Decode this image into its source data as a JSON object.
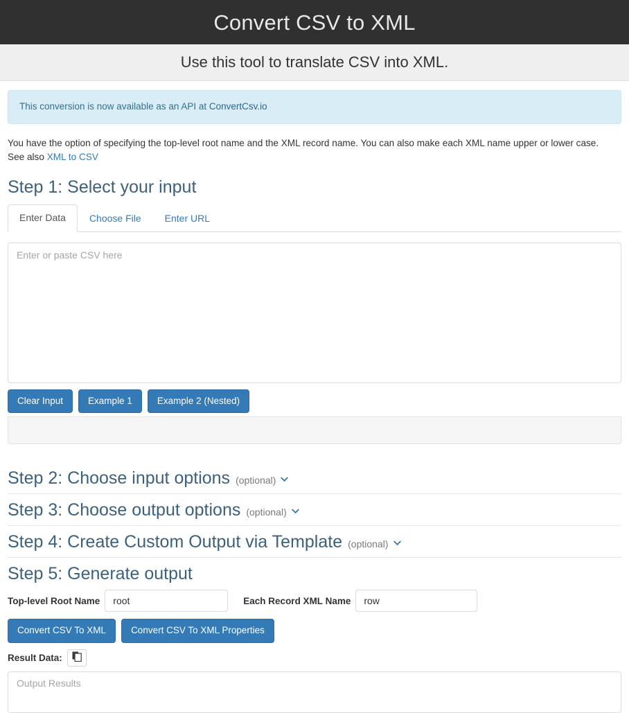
{
  "masthead": {
    "title": "Convert CSV to XML",
    "subtitle": "Use this tool to translate CSV into XML."
  },
  "alert": {
    "text_before": "This conversion is now available as an API at ",
    "link_label": "ConvertCsv.io",
    "bg_color": "#d9edf7",
    "text_color": "#31708f"
  },
  "intro": {
    "line1": "You have the option of specifying the top-level root name and the XML record name. You can also make each XML name upper or lower case.",
    "see_also_prefix": "See also ",
    "see_also_link": "XML to CSV"
  },
  "steps": {
    "step1": {
      "heading": "Step 1: Select your input",
      "tabs": [
        {
          "label": "Enter Data",
          "active": true
        },
        {
          "label": "Choose File",
          "active": false
        },
        {
          "label": "Enter URL",
          "active": false
        }
      ],
      "textarea_placeholder": "Enter or paste CSV here",
      "textarea_value": "",
      "buttons": [
        "Clear Input",
        "Example 1",
        "Example 2 (Nested)"
      ]
    },
    "step2": {
      "heading": "Step 2: Choose input options",
      "optional": "(optional)",
      "caret": "chevron-down-icon"
    },
    "step3": {
      "heading": "Step 3: Choose output options",
      "optional": "(optional)",
      "caret": "chevron-down-icon"
    },
    "step4": {
      "heading": "Step 4: Create Custom Output via Template",
      "optional": "(optional)",
      "caret": "chevron-down-icon"
    },
    "step5": {
      "heading": "Step 5: Generate output",
      "root_label": "Top-level Root Name",
      "root_value": "root",
      "record_label": "Each Record XML Name",
      "record_value": "row",
      "convert_button": "Convert CSV To XML",
      "convert_properties_button": "Convert CSV To XML Properties",
      "result_label": "Result Data:",
      "copy_icon": "copy-icon",
      "output_placeholder": "Output Results",
      "output_value": ""
    }
  },
  "colors": {
    "masthead_bg": "#303030",
    "subhead_bg": "#efefef",
    "primary_button": "#337ab7",
    "heading_blue": "#3b617f",
    "link_blue": "#337ab7"
  }
}
